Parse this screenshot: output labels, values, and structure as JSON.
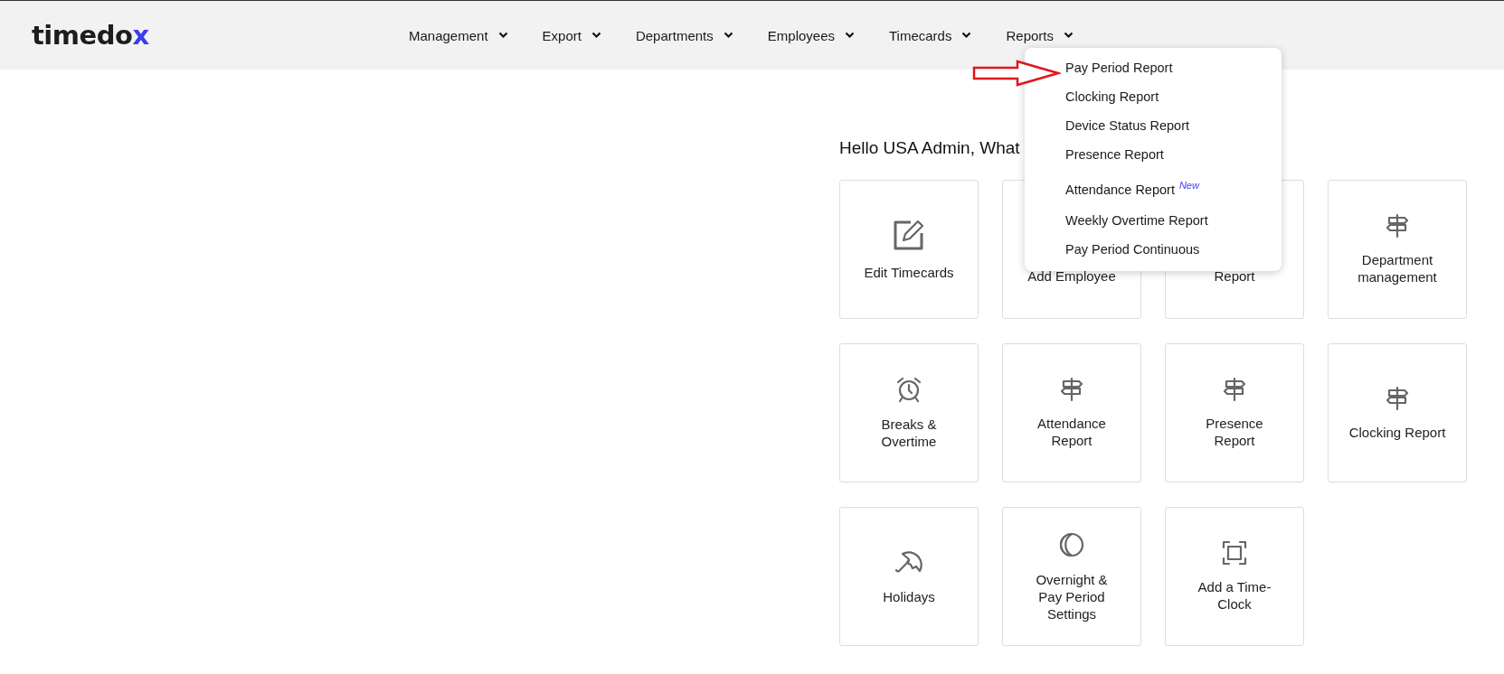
{
  "logo": {
    "text": "timedo",
    "accent": "x"
  },
  "nav": [
    {
      "label": "Management"
    },
    {
      "label": "Export"
    },
    {
      "label": "Departments"
    },
    {
      "label": "Employees"
    },
    {
      "label": "Timecards"
    },
    {
      "label": "Reports"
    }
  ],
  "greeting": "Hello USA Admin, What",
  "cards": [
    {
      "kind": "edit",
      "lines": [
        "Edit Timecards"
      ]
    },
    {
      "lines": [
        "Add Employee"
      ]
    },
    {
      "lines": [
        "Report"
      ]
    },
    {
      "kind": "signpost",
      "lines": [
        "Department",
        "management"
      ]
    },
    {
      "kind": "alarm",
      "lines": [
        "Breaks &",
        "Overtime"
      ]
    },
    {
      "kind": "signpost",
      "lines": [
        "Attendance",
        "Report"
      ]
    },
    {
      "kind": "signpost",
      "lines": [
        "Presence",
        "Report"
      ]
    },
    {
      "kind": "signpost",
      "lines": [
        "Clocking Report"
      ]
    },
    {
      "kind": "umbrella",
      "lines": [
        "Holidays"
      ]
    },
    {
      "kind": "moon",
      "lines": [
        "Overnight &",
        "Pay Period",
        "Settings"
      ]
    },
    {
      "kind": "frame",
      "lines": [
        "Add a Time-",
        "Clock"
      ]
    }
  ],
  "dropdown": {
    "items": [
      {
        "label": "Pay Period Report"
      },
      {
        "label": "Clocking Report"
      },
      {
        "label": "Device Status Report"
      },
      {
        "label": "Presence Report"
      },
      {
        "label": "Attendance Report",
        "badge": "New"
      },
      {
        "label": "Weekly Overtime Report"
      },
      {
        "label": "Pay Period Continuous"
      }
    ]
  }
}
